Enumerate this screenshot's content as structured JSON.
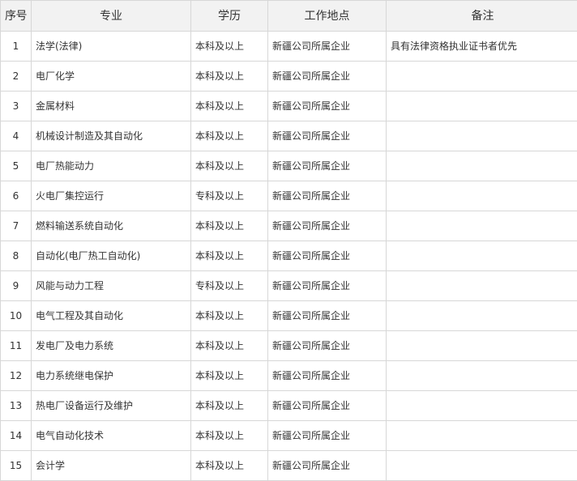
{
  "table": {
    "headers": [
      "序号",
      "专业",
      "学历",
      "工作地点",
      "备注"
    ],
    "rows": [
      {
        "num": "1",
        "major": "法学(法律)",
        "degree": "本科及以上",
        "location": "新疆公司所属企业",
        "note": "具有法律资格执业证书者优先"
      },
      {
        "num": "2",
        "major": "电厂化学",
        "degree": "本科及以上",
        "location": "新疆公司所属企业",
        "note": ""
      },
      {
        "num": "3",
        "major": "金属材料",
        "degree": "本科及以上",
        "location": "新疆公司所属企业",
        "note": ""
      },
      {
        "num": "4",
        "major": "机械设计制造及其自动化",
        "degree": "本科及以上",
        "location": "新疆公司所属企业",
        "note": ""
      },
      {
        "num": "5",
        "major": "电厂热能动力",
        "degree": "本科及以上",
        "location": "新疆公司所属企业",
        "note": ""
      },
      {
        "num": "6",
        "major": "火电厂集控运行",
        "degree": "专科及以上",
        "location": "新疆公司所属企业",
        "note": ""
      },
      {
        "num": "7",
        "major": "燃料输送系统自动化",
        "degree": "本科及以上",
        "location": "新疆公司所属企业",
        "note": ""
      },
      {
        "num": "8",
        "major": "自动化(电厂热工自动化)",
        "degree": "本科及以上",
        "location": "新疆公司所属企业",
        "note": ""
      },
      {
        "num": "9",
        "major": "风能与动力工程",
        "degree": "专科及以上",
        "location": "新疆公司所属企业",
        "note": ""
      },
      {
        "num": "10",
        "major": "电气工程及其自动化",
        "degree": "本科及以上",
        "location": "新疆公司所属企业",
        "note": ""
      },
      {
        "num": "11",
        "major": "发电厂及电力系统",
        "degree": "本科及以上",
        "location": "新疆公司所属企业",
        "note": ""
      },
      {
        "num": "12",
        "major": "电力系统继电保护",
        "degree": "本科及以上",
        "location": "新疆公司所属企业",
        "note": ""
      },
      {
        "num": "13",
        "major": "热电厂设备运行及维护",
        "degree": "本科及以上",
        "location": "新疆公司所属企业",
        "note": ""
      },
      {
        "num": "14",
        "major": "电气自动化技术",
        "degree": "本科及以上",
        "location": "新疆公司所属企业",
        "note": ""
      },
      {
        "num": "15",
        "major": "会计学",
        "degree": "本科及以上",
        "location": "新疆公司所属企业",
        "note": ""
      }
    ]
  }
}
